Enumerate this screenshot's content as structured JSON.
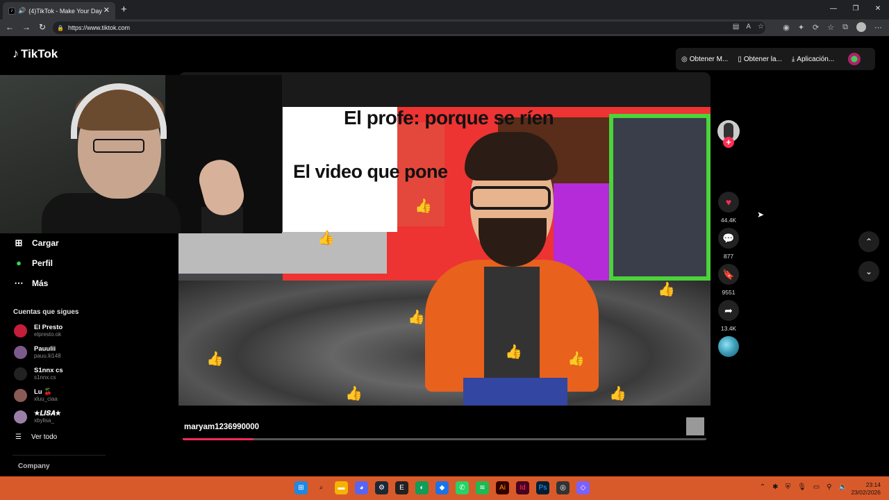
{
  "browser": {
    "tab_title": "(4)TikTok - Make Your Day",
    "tab_close": "✕",
    "new_tab": "+",
    "url": "https://www.tiktok.com",
    "window_controls": [
      "—",
      "❐",
      "✕"
    ]
  },
  "tiktok": {
    "logo": "TikTok",
    "header_actions": [
      {
        "label": "Obtener M...",
        "icon": "coin-icon"
      },
      {
        "label": "Obtener la...",
        "icon": "phone-icon"
      },
      {
        "label": "Aplicación...",
        "icon": "download-icon"
      }
    ],
    "sidebar": {
      "items": [
        {
          "label": "Cargar",
          "icon": "⊞"
        },
        {
          "label": "Perfil",
          "icon": "●"
        },
        {
          "label": "Más",
          "icon": "⋯"
        }
      ],
      "following_title": "Cuentas que sigues",
      "accounts": [
        {
          "name": "El Presto",
          "handle": "elpresto.ok",
          "color": "#c41e3a"
        },
        {
          "name": "Pauulii",
          "handle": "pauu.lii148",
          "color": "#7d5a8c"
        },
        {
          "name": "S1nnx cs",
          "handle": "s1nnx.cs",
          "color": "#222"
        },
        {
          "name": "Lu 🍒",
          "handle": "xluu_ciaa",
          "color": "#8a5a55"
        },
        {
          "name": "★𝑳𝑰𝑺𝑨★",
          "handle": "xbylisa_",
          "color": "#9b7fa8"
        }
      ],
      "see_all": "Ver todo",
      "company": "Company"
    },
    "video": {
      "caption_line1": "El profe: porque se ríen",
      "caption_line2": "El video que pone",
      "username": "maryam1236990000",
      "progress": 0.135
    },
    "actions": {
      "likes": "44.4K",
      "comments": "877",
      "saves": "9551",
      "shares": "13.4K"
    }
  },
  "taskbar": {
    "time": "23:14",
    "date": "23/02/2026"
  }
}
